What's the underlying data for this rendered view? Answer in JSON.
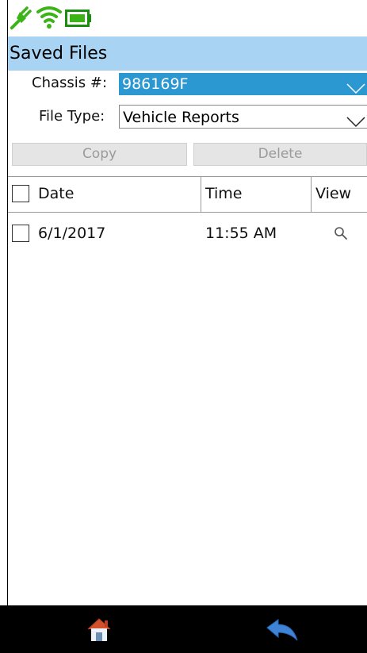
{
  "title": "Saved Files",
  "chassis": {
    "label": "Chassis #:",
    "value": "986169F"
  },
  "file_type": {
    "label": "File Type:",
    "value": "Vehicle Reports"
  },
  "buttons": {
    "copy": "Copy",
    "delete": "Delete"
  },
  "table": {
    "headers": {
      "date": "Date",
      "time": "Time",
      "view": "View"
    },
    "rows": [
      {
        "date": "6/1/2017",
        "time": "11:55 AM",
        "view_icon": "magnifier-icon"
      }
    ]
  },
  "status_icons": [
    "plug-icon",
    "wifi-icon",
    "battery-icon"
  ],
  "nav_icons": [
    "home-icon",
    "back-arrow-icon"
  ],
  "colors": {
    "title_bg": "#a9d3f2",
    "selected_bg": "#2c98d2",
    "status_green": "#3cb317",
    "nav_bar": "#000000"
  }
}
